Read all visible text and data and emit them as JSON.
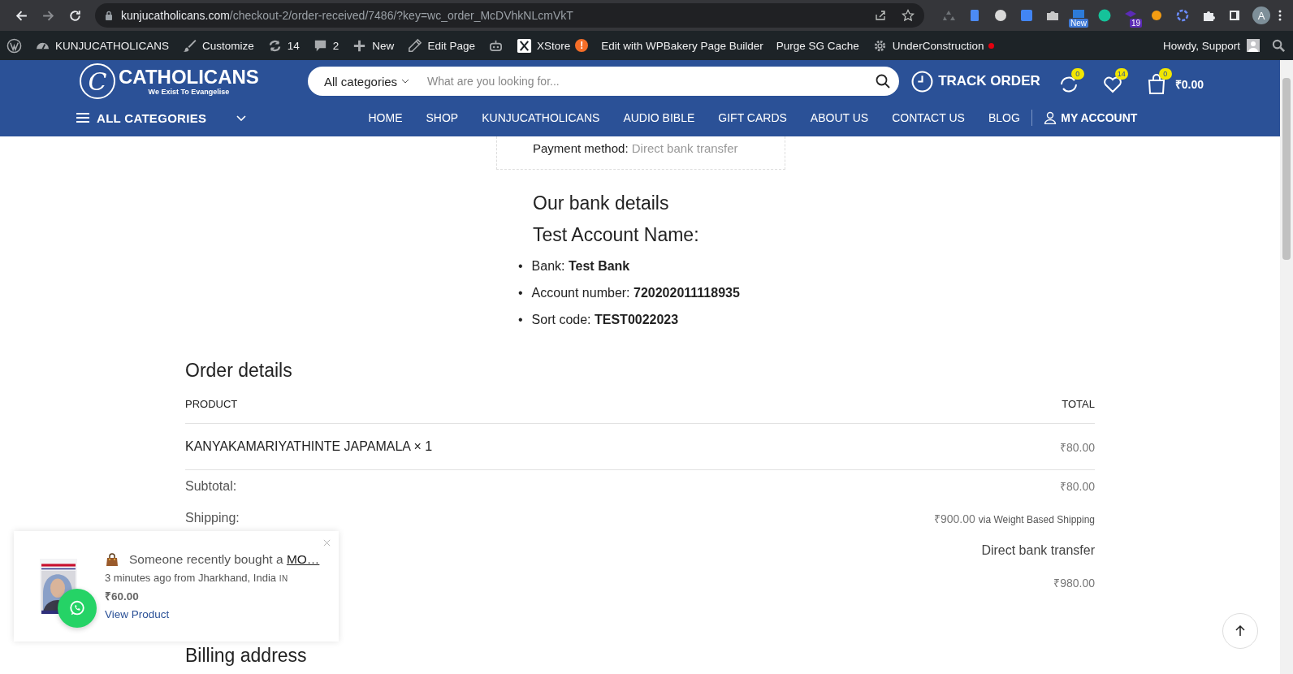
{
  "browser": {
    "url_domain": "kunjucatholicans.com",
    "url_path": "/checkout-2/order-received/7486/?key=wc_order_McDVhkNLcmVkT",
    "extensions": [
      {
        "kind": "recycle"
      },
      {
        "kind": "doc"
      },
      {
        "kind": "globe"
      },
      {
        "kind": "translate"
      },
      {
        "kind": "camera"
      },
      {
        "kind": "news",
        "badge": "New"
      },
      {
        "kind": "grammar"
      },
      {
        "kind": "cap",
        "badge": "19"
      },
      {
        "kind": "moon"
      },
      {
        "kind": "swirl"
      },
      {
        "kind": "puzzle"
      },
      {
        "kind": "panel"
      }
    ],
    "avatar": "A"
  },
  "admin_bar": {
    "items": [
      {
        "kind": "wp"
      },
      {
        "kind": "dashboard",
        "label": "KUNJUCATHOLICANS"
      },
      {
        "kind": "brush",
        "label": "Customize"
      },
      {
        "kind": "refresh",
        "label": "14"
      },
      {
        "kind": "comment",
        "label": "2"
      },
      {
        "kind": "plus",
        "label": "New"
      },
      {
        "kind": "pencil",
        "label": "Edit Page"
      },
      {
        "kind": "robot"
      },
      {
        "kind": "xstore",
        "label": "XStore",
        "alert": "!"
      },
      {
        "kind": "text",
        "label": "Edit with WPBakery Page Builder"
      },
      {
        "kind": "text",
        "label": "Purge SG Cache"
      },
      {
        "kind": "gear",
        "label": "UnderConstruction",
        "live": true
      }
    ],
    "greeting": "Howdy, Support"
  },
  "header": {
    "logo_mark": "C",
    "logo_name": "CATHOLICANS",
    "tagline": "We Exist To Evangelise",
    "search": {
      "category": "All categories",
      "placeholder": "What are you looking for..."
    },
    "track_order": "TRACK ORDER",
    "compare_count": "0",
    "wishlist_count": "14",
    "cart_count": "0",
    "cart_total": "₹0.00"
  },
  "nav": {
    "all_categories": "ALL CATEGORIES",
    "links": [
      "HOME",
      "SHOP",
      "KUNJUCATHOLICANS",
      "AUDIO BIBLE",
      "GIFT CARDS",
      "ABOUT US",
      "CONTACT US",
      "BLOG"
    ],
    "account": "MY ACCOUNT"
  },
  "payment_summary": {
    "label": "Payment method:",
    "value": "Direct bank transfer"
  },
  "bank": {
    "heading": "Our bank details",
    "account_name": "Test Account Name:",
    "fields": [
      {
        "marker": "•",
        "label": "Bank:",
        "value": "Test Bank"
      },
      {
        "marker": "•",
        "label": "Account number:",
        "value": "720202011118935"
      },
      {
        "marker": "•",
        "label": "Sort code:",
        "value": "TEST0022023"
      }
    ]
  },
  "order": {
    "title": "Order details",
    "columns": [
      "PRODUCT",
      "TOTAL"
    ],
    "items": [
      {
        "product": "KANYAKAMARIYATHINTE JAPAMALA × 1",
        "total": "₹80.00"
      }
    ],
    "totals": [
      {
        "label": "Subtotal:",
        "value": "₹80.00"
      },
      {
        "label": "Shipping:",
        "value": "₹900.00",
        "note": "via Weight Based Shipping"
      },
      {
        "value": "Direct bank transfer",
        "kind": "plain"
      },
      {
        "value": "₹980.00"
      }
    ]
  },
  "billing_heading": "Billing address",
  "popup": {
    "message": "Someone recently bought a",
    "product": "MO…",
    "time": "3 minutes ago from Jharkhand, India",
    "country": "IN",
    "price": "₹60.00",
    "link": "View Product"
  }
}
